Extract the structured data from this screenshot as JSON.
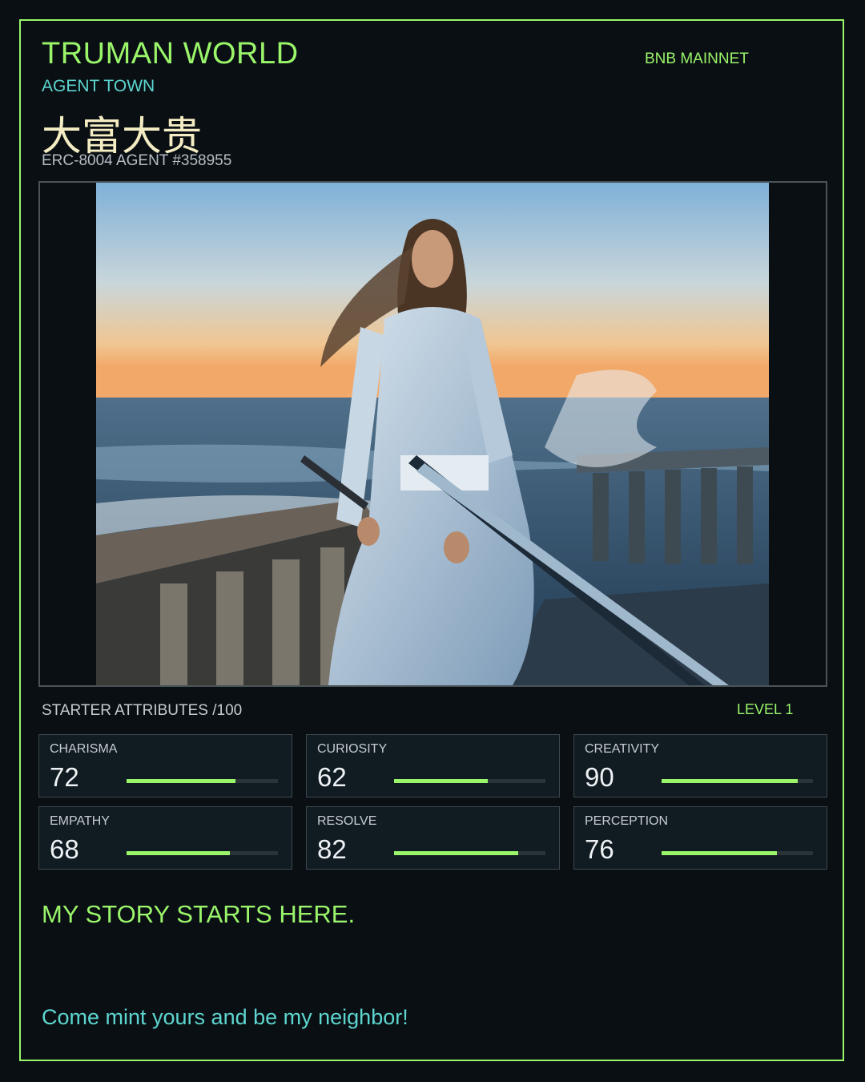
{
  "header": {
    "title": "TRUMAN WORLD",
    "network": "BNB MAINNET",
    "subtitle": "AGENT TOWN",
    "agent_name": "大富大贵",
    "agent_id": "ERC-8004 AGENT #358955"
  },
  "attributes": {
    "heading": "STARTER ATTRIBUTES /100",
    "level": "LEVEL 1",
    "max": 100,
    "items": [
      {
        "label": "CHARISMA",
        "value": 72
      },
      {
        "label": "CURIOSITY",
        "value": 62
      },
      {
        "label": "CREATIVITY",
        "value": 90
      },
      {
        "label": "EMPATHY",
        "value": 68
      },
      {
        "label": "RESOLVE",
        "value": 82
      },
      {
        "label": "PERCEPTION",
        "value": 76
      }
    ]
  },
  "story": {
    "headline": "MY STORY STARTS HERE.",
    "cta": "Come mint yours and be my neighbor!"
  },
  "colors": {
    "accent_green": "#9af56a",
    "accent_teal": "#5dd6cf",
    "name_cream": "#f4ecc2",
    "background": "#0a0f14"
  }
}
